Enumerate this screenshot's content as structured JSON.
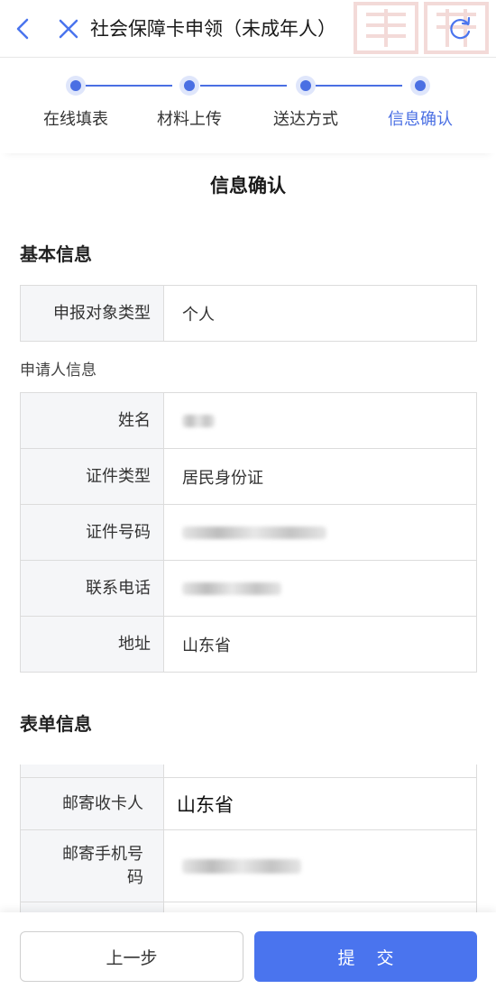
{
  "header": {
    "title": "社会保障卡申领（未成年人）"
  },
  "stepper": {
    "steps": [
      {
        "label": "在线填表"
      },
      {
        "label": "材料上传"
      },
      {
        "label": "送达方式"
      },
      {
        "label": "信息确认"
      }
    ],
    "active_step": 4,
    "accent_color": "#4a6fe3"
  },
  "page": {
    "heading": "信息确认"
  },
  "basic_info": {
    "title": "基本信息",
    "rows": [
      {
        "key": "申报对象类型",
        "value": "个人"
      }
    ]
  },
  "applicant": {
    "title": "申请人信息",
    "rows": [
      {
        "key": "姓名",
        "value": ""
      },
      {
        "key": "证件类型",
        "value": "居民身份证"
      },
      {
        "key": "证件号码",
        "value": ""
      },
      {
        "key": "联系电话",
        "value": ""
      },
      {
        "key": "地址",
        "value": "山东省"
      }
    ]
  },
  "form_info": {
    "title": "表单信息",
    "rows": [
      {
        "key": "邮寄收卡人",
        "value": "山东省"
      },
      {
        "key": "邮寄手机号码",
        "value": ""
      }
    ]
  },
  "footer": {
    "prev_label": "上一步",
    "submit_label": "提交",
    "submit_color": "#4a74ee"
  },
  "icons": [
    "back-arrow-icon",
    "close-icon",
    "refresh-icon"
  ]
}
